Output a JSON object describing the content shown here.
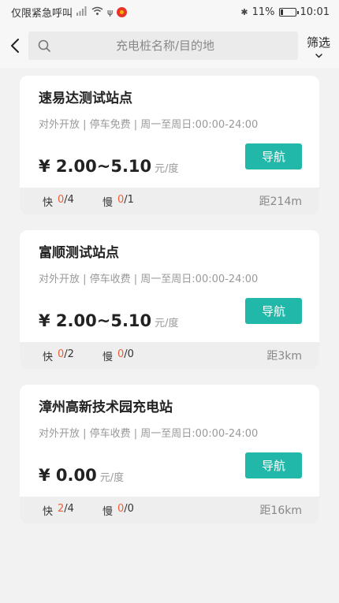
{
  "status_bar": {
    "left_text": "仅限紧急呼叫",
    "battery": "11%",
    "time": "10:01"
  },
  "header": {
    "search_placeholder": "充电桩名称/目的地",
    "filter_label": "筛选"
  },
  "stations": [
    {
      "name": "速易达测试站点",
      "info": "对外开放 | 停车免费 | 周一至周日:00:00-24:00",
      "price": "¥ 2.00~5.10",
      "unit": "元/度",
      "nav_label": "导航",
      "fast_label": "快",
      "fast_available": "0",
      "fast_total": "/4",
      "slow_label": "慢",
      "slow_available": "0",
      "slow_total": "/1",
      "distance": "距214m"
    },
    {
      "name": "富顺测试站点",
      "info": "对外开放 | 停车收费 | 周一至周日:00:00-24:00",
      "price": "¥ 2.00~5.10",
      "unit": "元/度",
      "nav_label": "导航",
      "fast_label": "快",
      "fast_available": "0",
      "fast_total": "/2",
      "slow_label": "慢",
      "slow_available": "0",
      "slow_total": "/0",
      "distance": "距3km"
    },
    {
      "name": "漳州高新技术园充电站",
      "info": "对外开放 | 停车收费 | 周一至周日:00:00-24:00",
      "price": "¥ 0.00",
      "unit": "元/度",
      "nav_label": "导航",
      "fast_label": "快",
      "fast_available": "2",
      "fast_total": "/4",
      "slow_label": "慢",
      "slow_available": "0",
      "slow_total": "/0",
      "distance": "距16km"
    }
  ],
  "colors": {
    "accent": "#21b7a9",
    "available": "#e8603c"
  }
}
